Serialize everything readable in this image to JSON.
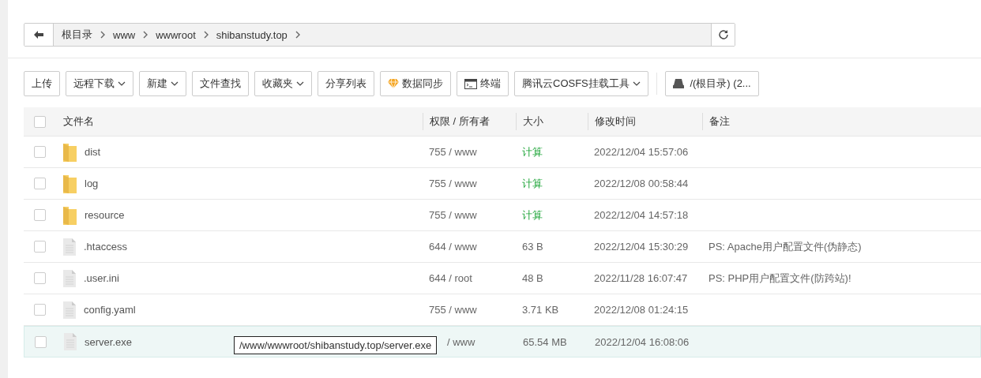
{
  "breadcrumb": [
    "根目录",
    "www",
    "wwwroot",
    "shibanstudy.top"
  ],
  "toolbar": [
    {
      "label": "上传",
      "dropdown": false
    },
    {
      "label": "远程下载",
      "dropdown": true
    },
    {
      "label": "新建",
      "dropdown": true
    },
    {
      "label": "文件查找",
      "dropdown": false
    },
    {
      "label": "收藏夹",
      "dropdown": true
    },
    {
      "label": "分享列表",
      "dropdown": false
    },
    {
      "label": "数据同步",
      "dropdown": false,
      "kind": "gem"
    },
    {
      "label": "终端",
      "dropdown": false,
      "kind": "terminal"
    },
    {
      "label": "腾讯云COSFS挂载工具",
      "dropdown": true
    }
  ],
  "disk_button": {
    "label": "/(根目录) (2..."
  },
  "table": {
    "select_all_checked": false,
    "columns": [
      "文件名",
      "权限 / 所有者",
      "大小",
      "修改时间",
      "备注"
    ],
    "rows": [
      {
        "kind": "folder",
        "name": "dist",
        "permission": "755 / www",
        "size": "计算",
        "size_link": true,
        "modified": "2022/12/04 15:57:06",
        "checked": false,
        "hovered": false
      },
      {
        "kind": "folder",
        "name": "log",
        "permission": "755 / www",
        "size": "计算",
        "size_link": true,
        "modified": "2022/12/08 00:58:44",
        "checked": false,
        "hovered": false
      },
      {
        "kind": "folder",
        "name": "resource",
        "permission": "755 / www",
        "size": "计算",
        "size_link": true,
        "modified": "2022/12/04 14:57:18",
        "checked": false,
        "hovered": false
      },
      {
        "kind": "file",
        "name": ".htaccess",
        "permission": "644 / www",
        "size": "63 B",
        "size_link": false,
        "modified": "2022/12/04 15:30:29",
        "note": "PS: Apache用户配置文件(伪静态)",
        "checked": false,
        "hovered": false
      },
      {
        "kind": "file",
        "name": ".user.ini",
        "permission": "644 / root",
        "size": "48 B",
        "size_link": false,
        "modified": "2022/11/28 16:07:47",
        "note": "PS: PHP用户配置文件(防跨站)!",
        "checked": false,
        "hovered": false
      },
      {
        "kind": "file",
        "name": "config.yaml",
        "permission": "755 / www",
        "size": "3.71 KB",
        "size_link": false,
        "modified": "2022/12/08 01:24:15",
        "checked": false,
        "hovered": false
      },
      {
        "kind": "file",
        "name": "server.exe",
        "permission": "/ www",
        "size": "65.54 MB",
        "size_link": false,
        "modified": "2022/12/04 16:08:06",
        "checked": false,
        "hovered": true,
        "tooltip": "/www/wwwroot/shibanstudy.top/server.exe"
      }
    ]
  }
}
